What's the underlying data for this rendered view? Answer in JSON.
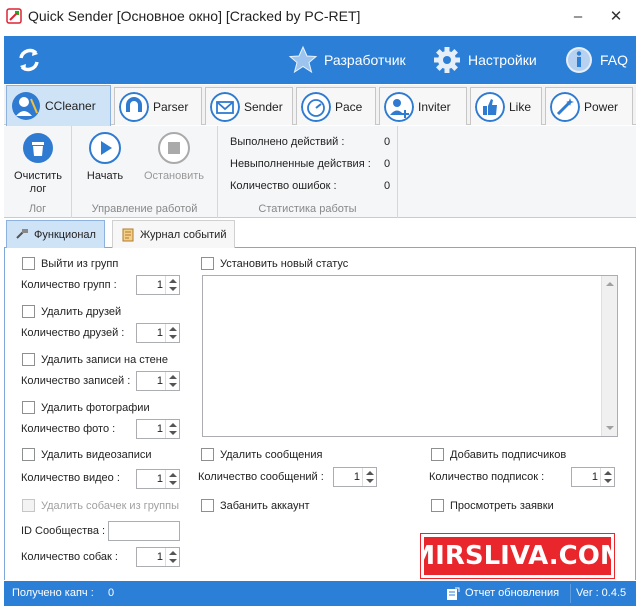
{
  "window": {
    "title": "Quick Sender [Основное окно] [Cracked by PC-RET]",
    "minimize": "–",
    "close": "✕"
  },
  "header": {
    "developer": "Разработчик",
    "settings": "Настройки",
    "faq": "FAQ"
  },
  "tabs": [
    {
      "label": "CCleaner",
      "icon": "broom-user-icon",
      "active": true
    },
    {
      "label": "Parser",
      "icon": "magnet-icon"
    },
    {
      "label": "Sender",
      "icon": "envelope-icon"
    },
    {
      "label": "Pace",
      "icon": "clock-icon"
    },
    {
      "label": "Inviter",
      "icon": "add-user-icon"
    },
    {
      "label": "Like",
      "icon": "thumbs-up-icon"
    },
    {
      "label": "Power",
      "icon": "magic-wand-icon"
    }
  ],
  "ribbon": {
    "clear_log": "Очистить лог",
    "clear_log_line1": "Очистить",
    "clear_log_line2": "лог",
    "group_log": "Лог",
    "start": "Начать",
    "stop": "Остановить",
    "group_control": "Управление работой",
    "stats": [
      {
        "label": "Выполнено действий :",
        "value": "0"
      },
      {
        "label": "Невыполненные действия :",
        "value": "0"
      },
      {
        "label": "Количество ошибок :",
        "value": "0"
      }
    ],
    "group_stats": "Статистика работы"
  },
  "inner_tabs": {
    "functional": "Функционал",
    "event_log": "Журнал событий"
  },
  "form": {
    "leave_groups": "Выйти из групп",
    "groups_count_label": "Количество групп :",
    "groups_count": "1",
    "delete_friends": "Удалить друзей",
    "friends_count_label": "Количество друзей :",
    "friends_count": "1",
    "delete_wall_posts": "Удалить записи на стене",
    "posts_count_label": "Количество записей :",
    "posts_count": "1",
    "delete_photos": "Удалить фотографии",
    "photos_count_label": "Количество фото :",
    "photos_count": "1",
    "delete_videos": "Удалить видеозаписи",
    "videos_count_label": "Количество видео :",
    "videos_count": "1",
    "delete_dogs": "Удалить собачек из группы",
    "community_id_label": "ID Сообщества :",
    "community_id": "",
    "dogs_count_label": "Количество собак :",
    "dogs_count": "1",
    "set_status": "Установить новый статус",
    "status_text": "",
    "delete_messages": "Удалить сообщения",
    "messages_count_label": "Количество сообщений :",
    "messages_count": "1",
    "ban_account": "Забанить аккаунт",
    "add_subscribers": "Добавить подписчиков",
    "subscribers_count_label": "Количество подписок :",
    "subscribers_count": "1",
    "view_requests": "Просмотреть заявки"
  },
  "watermark": "MIRSLIVA.COM",
  "statusbar": {
    "captcha_label": "Получено капч :",
    "captcha_value": "0",
    "update_report": "Отчет обновления",
    "version": "Ver : 0.4.5"
  },
  "colors": {
    "accent": "#2b7fd6",
    "tab_active": "#cfe3f7",
    "watermark": "#e8262b"
  }
}
